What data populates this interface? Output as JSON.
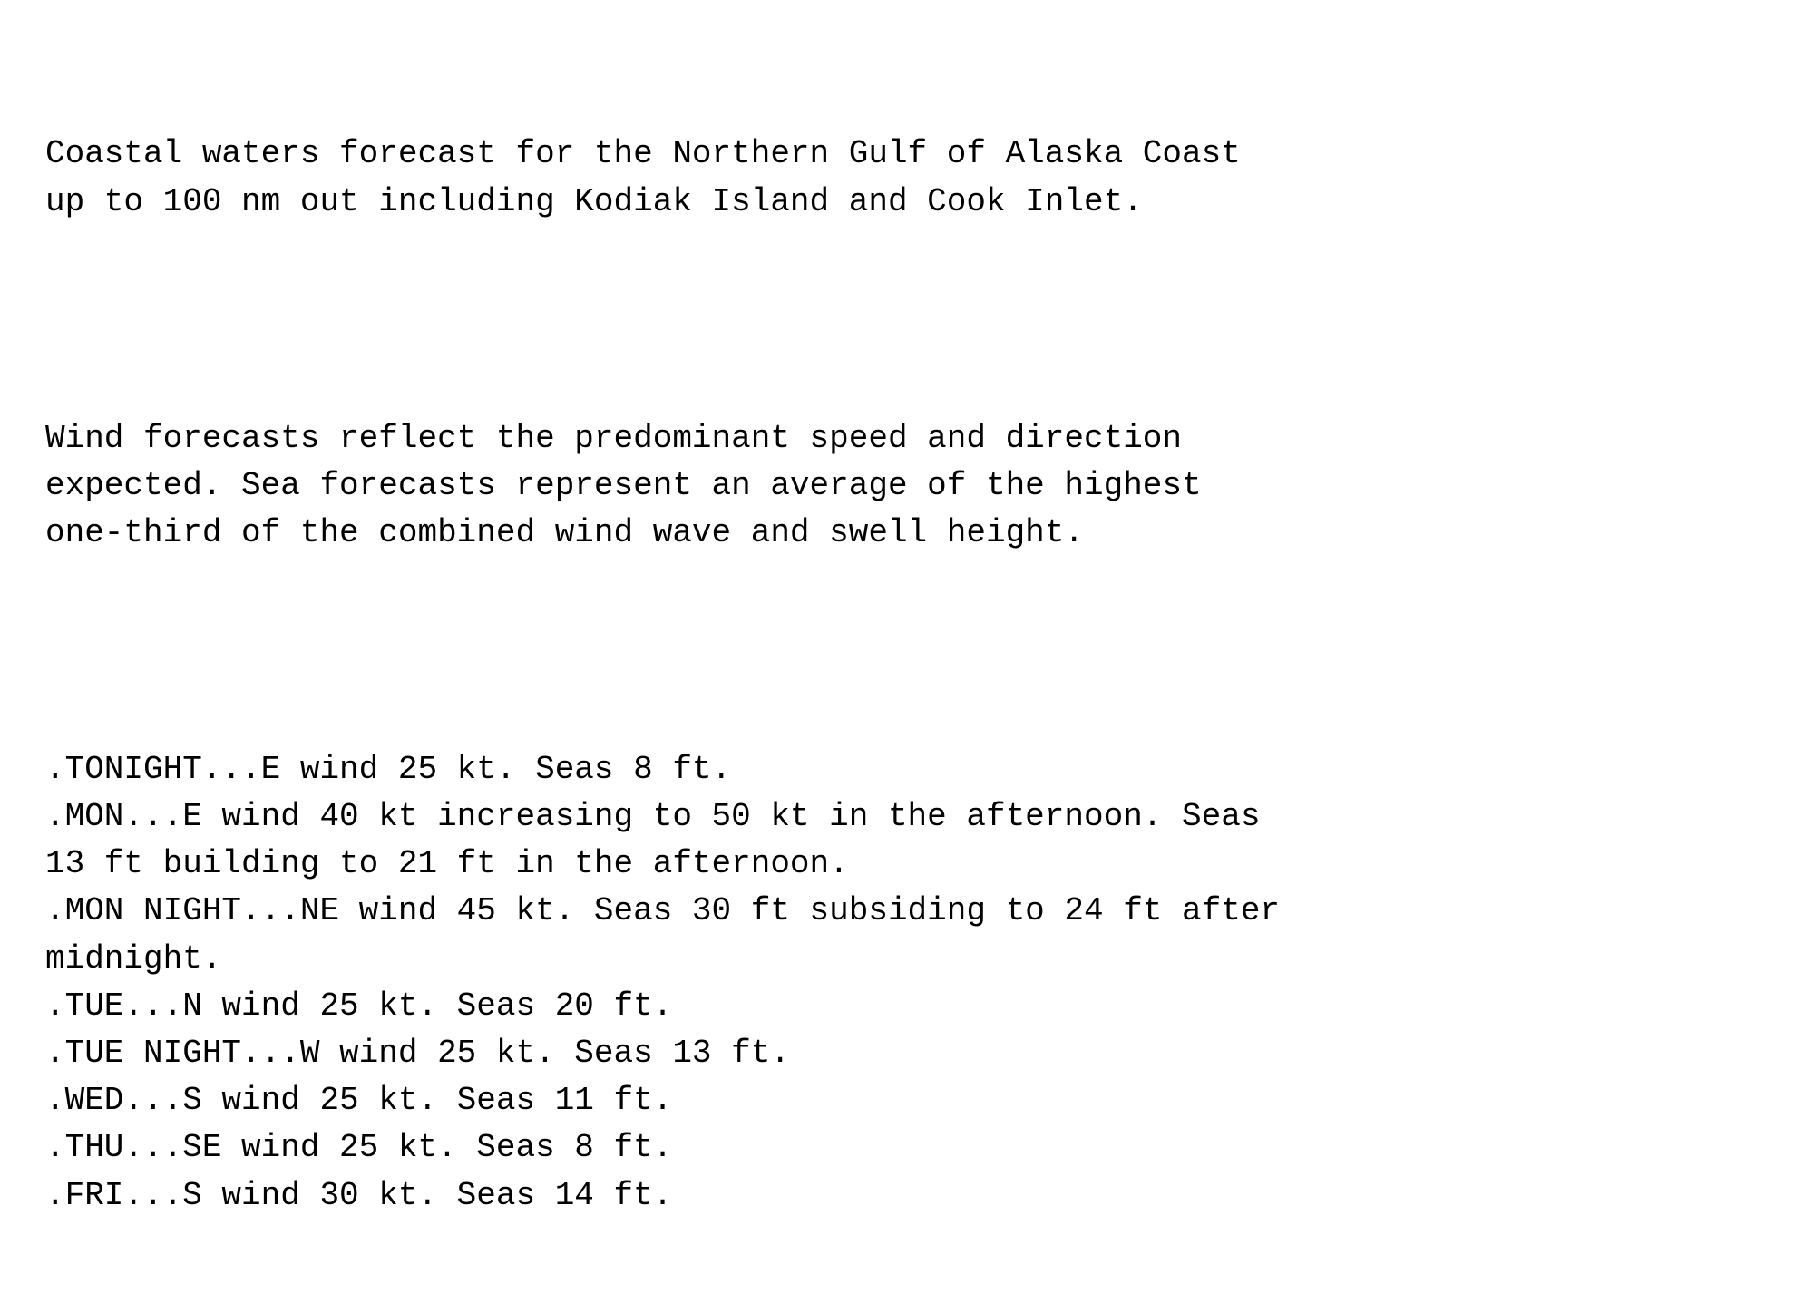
{
  "forecast": {
    "header": "Coastal waters forecast for the Northern Gulf of Alaska Coast\nup to 100 nm out including Kodiak Island and Cook Inlet.",
    "wind_note": "Wind forecasts reflect the predominant speed and direction\nexpected. Sea forecasts represent an average of the highest\none-third of the combined wind wave and swell height.",
    "periods": [
      ".TONIGHT...E wind 25 kt. Seas 8 ft.",
      ".MON...E wind 40 kt increasing to 50 kt in the afternoon. Seas\n13 ft building to 21 ft in the afternoon.",
      ".MON NIGHT...NE wind 45 kt. Seas 30 ft subsiding to 24 ft after\nmidnight.",
      ".TUE...N wind 25 kt. Seas 20 ft.",
      ".TUE NIGHT...W wind 25 kt. Seas 13 ft.",
      ".WED...S wind 25 kt. Seas 11 ft.",
      ".THU...SE wind 25 kt. Seas 8 ft.",
      ".FRI...S wind 30 kt. Seas 14 ft."
    ]
  }
}
